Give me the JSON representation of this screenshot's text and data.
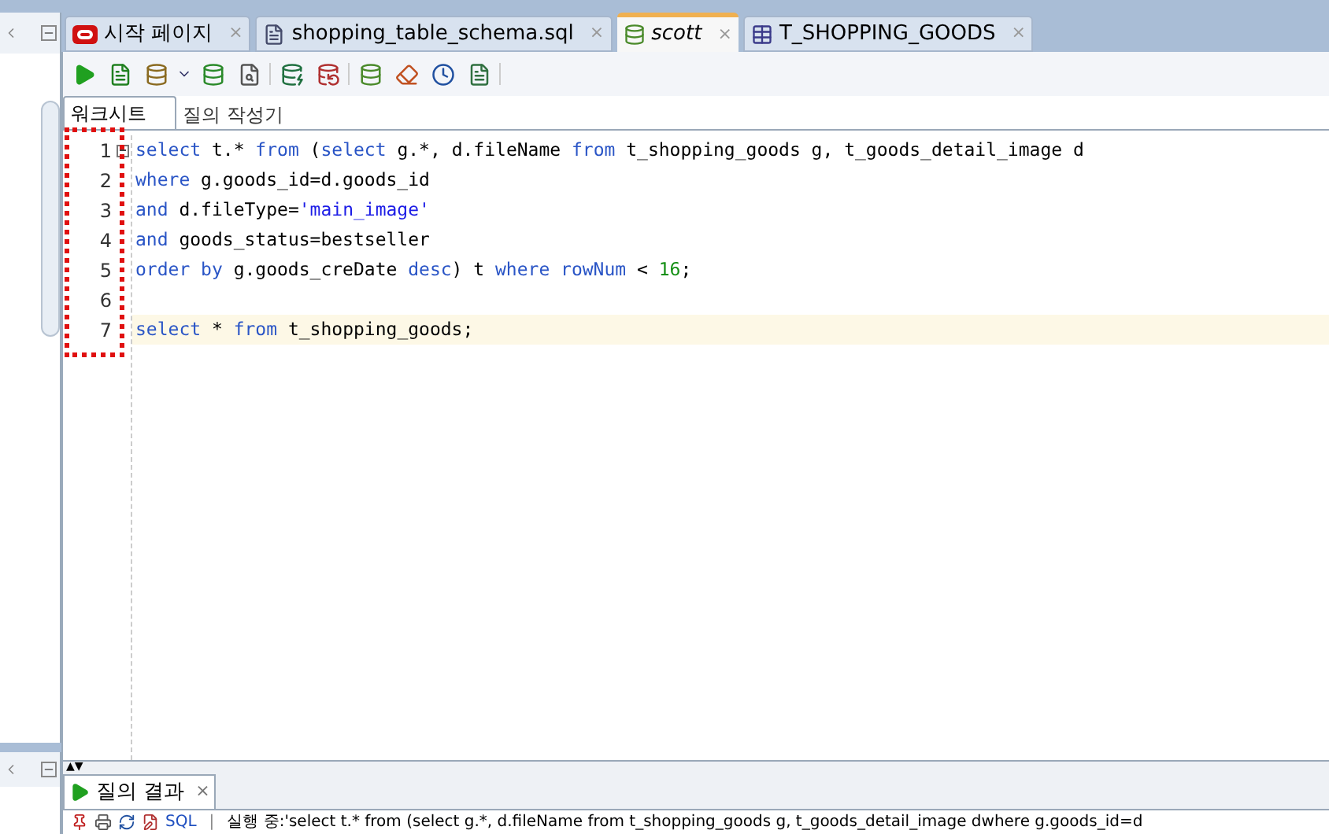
{
  "editor_tabs": [
    {
      "label": "시작 페이지",
      "kind": "start",
      "selected": false,
      "close": "×"
    },
    {
      "label": "shopping_table_schema.sql",
      "kind": "file",
      "selected": false,
      "close": "×"
    },
    {
      "label": "scott",
      "kind": "worksheet",
      "selected": true,
      "close": "×"
    },
    {
      "label": "T_SHOPPING_GOODS",
      "kind": "table",
      "selected": false,
      "close": "×"
    }
  ],
  "subtabs": [
    {
      "label": "워크시트",
      "selected": true
    },
    {
      "label": "질의 작성기",
      "selected": false
    }
  ],
  "code_lines": [
    {
      "number": "1",
      "current": false,
      "fold": true,
      "tokens": [
        {
          "kind": "keyword",
          "text": "select "
        },
        {
          "kind": "plain",
          "text": "t.* "
        },
        {
          "kind": "keyword",
          "text": "from "
        },
        {
          "kind": "plain",
          "text": "("
        },
        {
          "kind": "keyword",
          "text": "select "
        },
        {
          "kind": "plain",
          "text": "g.*, d.fileName "
        },
        {
          "kind": "keyword",
          "text": "from "
        },
        {
          "kind": "plain",
          "text": "t_shopping_goods g, t_goods_detail_image d"
        }
      ]
    },
    {
      "number": "2",
      "current": false,
      "fold": false,
      "tokens": [
        {
          "kind": "keyword",
          "text": "where "
        },
        {
          "kind": "plain",
          "text": "g.goods_id=d.goods_id"
        }
      ]
    },
    {
      "number": "3",
      "current": false,
      "fold": false,
      "tokens": [
        {
          "kind": "keyword",
          "text": "and "
        },
        {
          "kind": "plain",
          "text": "d.fileType="
        },
        {
          "kind": "string",
          "text": "'main_image'"
        }
      ]
    },
    {
      "number": "4",
      "current": false,
      "fold": false,
      "tokens": [
        {
          "kind": "keyword",
          "text": "and "
        },
        {
          "kind": "plain",
          "text": "goods_status=bestseller"
        }
      ]
    },
    {
      "number": "5",
      "current": false,
      "fold": false,
      "tokens": [
        {
          "kind": "keyword",
          "text": "order by "
        },
        {
          "kind": "plain",
          "text": "g.goods_creDate "
        },
        {
          "kind": "keyword",
          "text": "desc"
        },
        {
          "kind": "plain",
          "text": ") t "
        },
        {
          "kind": "keyword",
          "text": "where rowNum "
        },
        {
          "kind": "plain",
          "text": "< "
        },
        {
          "kind": "number",
          "text": "16"
        },
        {
          "kind": "plain",
          "text": ";"
        }
      ]
    },
    {
      "number": "6",
      "current": false,
      "fold": false
    },
    {
      "number": "7",
      "current": true,
      "fold": false,
      "tokens": [
        {
          "kind": "keyword",
          "text": "select "
        },
        {
          "kind": "plain",
          "text": "* "
        },
        {
          "kind": "keyword",
          "text": "from "
        },
        {
          "kind": "plain",
          "text": "t_shopping_goods;"
        }
      ]
    }
  ],
  "splitter_arrows": "▲▼",
  "results": {
    "tab": {
      "label": "질의 결과",
      "close": "×"
    },
    "sql_link": "SQL",
    "separator": "|",
    "status": "실행 중:'select t.* from (select g.*, d.fileName from t_shopping_goods g, t_goods_detail_image dwhere g.goods_id=d"
  }
}
